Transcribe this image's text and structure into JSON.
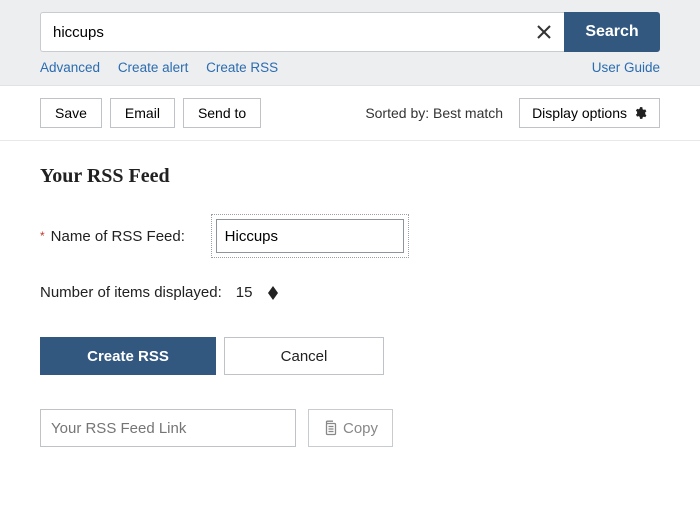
{
  "search": {
    "query": "hiccups",
    "button": "Search",
    "links": {
      "advanced": "Advanced",
      "create_alert": "Create alert",
      "create_rss": "Create RSS",
      "user_guide": "User Guide"
    }
  },
  "toolbar": {
    "save": "Save",
    "email": "Email",
    "send_to": "Send to",
    "sorted_by_label": "Sorted by:",
    "sorted_by_value": "Best match",
    "display_options": "Display options"
  },
  "rss": {
    "heading": "Your RSS Feed",
    "name_label": "Name of RSS Feed:",
    "name_value": "Hiccups",
    "items_label": "Number of items displayed:",
    "items_value": "15",
    "create_button": "Create RSS",
    "cancel_button": "Cancel",
    "link_placeholder": "Your RSS Feed Link",
    "copy_button": "Copy"
  }
}
